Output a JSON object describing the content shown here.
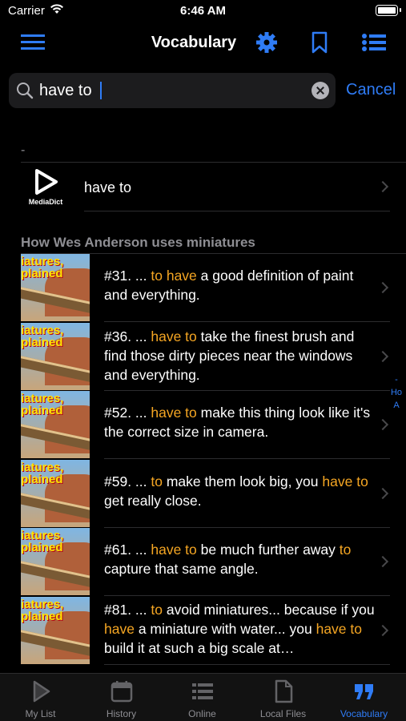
{
  "status_bar": {
    "carrier": "Carrier",
    "time": "6:46 AM"
  },
  "nav": {
    "title": "Vocabulary"
  },
  "search": {
    "value": "have to",
    "cancel": "Cancel"
  },
  "results": {
    "section_label": "-",
    "dictionary": {
      "logo_text": "MediaDict",
      "word": "have to"
    }
  },
  "video": {
    "title": "How Wes Anderson uses miniatures",
    "thumbnail_line1": "iatures,",
    "thumbnail_line2": "plained",
    "entries": [
      {
        "num": "#31.",
        "parts": [
          {
            "t": " ... ",
            "h": false
          },
          {
            "t": "to have",
            "h": true
          },
          {
            "t": " a good definition of paint and everything.",
            "h": false
          }
        ]
      },
      {
        "num": "#36.",
        "parts": [
          {
            "t": " ... ",
            "h": false
          },
          {
            "t": "have to",
            "h": true
          },
          {
            "t": " take the finest brush and find those dirty pieces near the windows and everything.",
            "h": false
          }
        ]
      },
      {
        "num": "#52.",
        "parts": [
          {
            "t": " ... ",
            "h": false
          },
          {
            "t": "have to",
            "h": true
          },
          {
            "t": " make this thing look like it's the correct size in camera.",
            "h": false
          }
        ]
      },
      {
        "num": "#59.",
        "parts": [
          {
            "t": " ... ",
            "h": false
          },
          {
            "t": "to",
            "h": true
          },
          {
            "t": " make them look big, you ",
            "h": false
          },
          {
            "t": "have to",
            "h": true
          },
          {
            "t": " get really close.",
            "h": false
          }
        ]
      },
      {
        "num": "#61.",
        "parts": [
          {
            "t": " ... ",
            "h": false
          },
          {
            "t": "have to",
            "h": true
          },
          {
            "t": " be much further away ",
            "h": false
          },
          {
            "t": "to",
            "h": true
          },
          {
            "t": " capture that same angle.",
            "h": false
          }
        ]
      },
      {
        "num": "#81.",
        "parts": [
          {
            "t": " ... ",
            "h": false
          },
          {
            "t": "to",
            "h": true
          },
          {
            "t": " avoid miniatures... because if you ",
            "h": false
          },
          {
            "t": "have",
            "h": true
          },
          {
            "t": " a miniature with water... you ",
            "h": false
          },
          {
            "t": "have to",
            "h": true
          },
          {
            "t": " build it at such a big scale at…",
            "h": false
          }
        ]
      }
    ]
  },
  "side_index": [
    "-",
    "Ho",
    "A"
  ],
  "tabs": [
    {
      "label": "My List",
      "icon": "play-icon"
    },
    {
      "label": "History",
      "icon": "calendar-icon"
    },
    {
      "label": "Online",
      "icon": "list-icon"
    },
    {
      "label": "Local Files",
      "icon": "document-icon"
    },
    {
      "label": "Vocabulary",
      "icon": "quote-icon",
      "active": true
    }
  ],
  "colors": {
    "accent": "#2f7cf6",
    "highlight": "#f5a623",
    "background": "#000000"
  }
}
